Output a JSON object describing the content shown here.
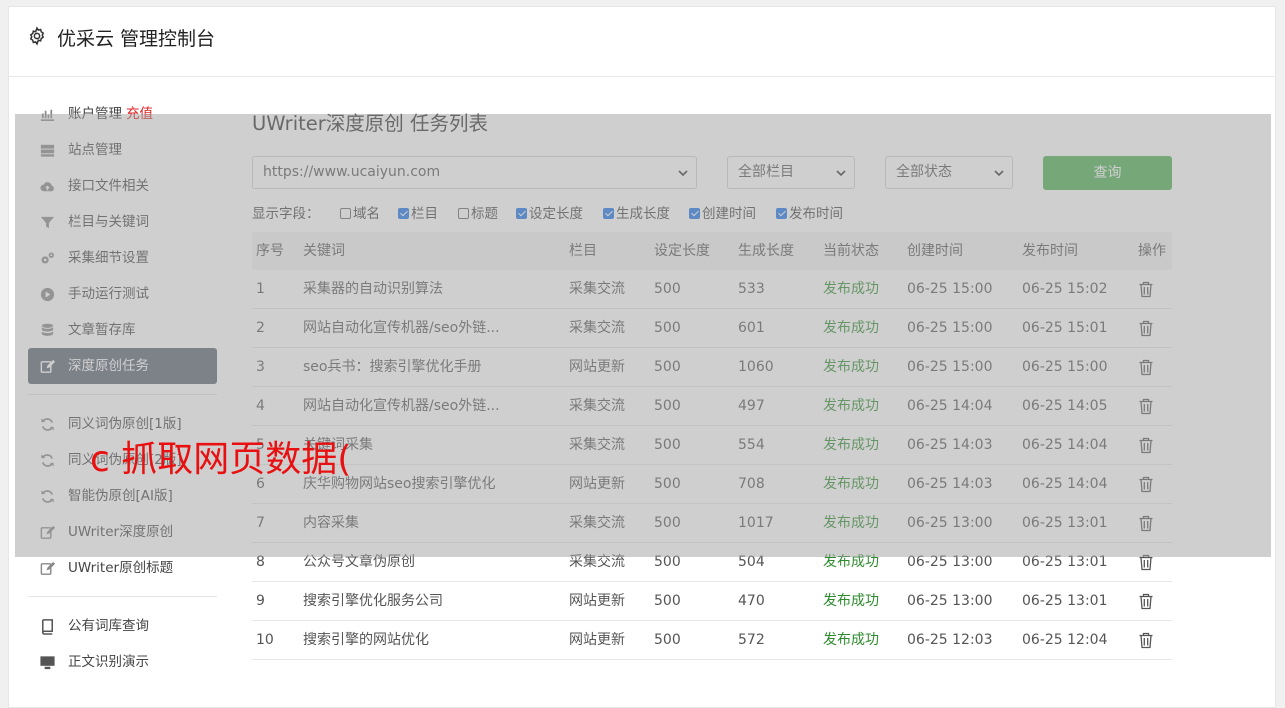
{
  "header": {
    "title": "优采云 管理控制台"
  },
  "sidebar": {
    "group1": [
      {
        "label": "账户管理",
        "extra": "充值",
        "icon": "bar-chart-icon"
      },
      {
        "label": "站点管理",
        "icon": "server-icon"
      },
      {
        "label": "接口文件相关",
        "icon": "cloud-upload-icon"
      },
      {
        "label": "栏目与关键词",
        "icon": "filter-icon"
      },
      {
        "label": "采集细节设置",
        "icon": "gears-icon"
      },
      {
        "label": "手动运行测试",
        "icon": "play-circle-icon"
      },
      {
        "label": "文章暂存库",
        "icon": "database-icon"
      },
      {
        "label": "深度原创任务",
        "icon": "edit-icon",
        "active": true
      }
    ],
    "group2": [
      {
        "label": "同义词伪原创[1版]",
        "icon": "refresh-icon"
      },
      {
        "label": "同义词伪原创[2版]",
        "icon": "refresh-icon"
      },
      {
        "label": "智能伪原创[AI版]",
        "icon": "refresh-icon"
      },
      {
        "label": "UWriter深度原创",
        "icon": "edit-icon"
      },
      {
        "label": "UWriter原创标题",
        "icon": "edit-icon"
      }
    ],
    "group3": [
      {
        "label": "公有词库查询",
        "icon": "book-icon"
      },
      {
        "label": "正文识别演示",
        "icon": "monitor-icon"
      }
    ]
  },
  "main": {
    "title": "UWriter深度原创 任务列表",
    "site_select": "https://www.ucaiyun.com",
    "column_select": "全部栏目",
    "status_select": "全部状态",
    "query_label": "查询",
    "fields_label": "显示字段：",
    "fields": [
      {
        "label": "域名",
        "checked": false
      },
      {
        "label": "栏目",
        "checked": true
      },
      {
        "label": "标题",
        "checked": false
      },
      {
        "label": "设定长度",
        "checked": true
      },
      {
        "label": "生成长度",
        "checked": true
      },
      {
        "label": "创建时间",
        "checked": true
      },
      {
        "label": "发布时间",
        "checked": true
      }
    ]
  },
  "table": {
    "headers": [
      "序号",
      "关键词",
      "栏目",
      "设定长度",
      "生成长度",
      "当前状态",
      "创建时间",
      "发布时间",
      "操作"
    ],
    "rows": [
      [
        "1",
        "采集器的自动识别算法",
        "采集交流",
        "500",
        "533",
        "发布成功",
        "06-25 15:00",
        "06-25 15:02"
      ],
      [
        "2",
        "网站自动化宣传机器/seo外链...",
        "采集交流",
        "500",
        "601",
        "发布成功",
        "06-25 15:00",
        "06-25 15:01"
      ],
      [
        "3",
        "seo兵书：搜索引擎优化手册",
        "网站更新",
        "500",
        "1060",
        "发布成功",
        "06-25 15:00",
        "06-25 15:00"
      ],
      [
        "4",
        "网站自动化宣传机器/seo外链...",
        "采集交流",
        "500",
        "497",
        "发布成功",
        "06-25 14:04",
        "06-25 14:05"
      ],
      [
        "5",
        "关键词采集",
        "采集交流",
        "500",
        "554",
        "发布成功",
        "06-25 14:03",
        "06-25 14:04"
      ],
      [
        "6",
        "庆华购物网站seo搜索引擎优化",
        "网站更新",
        "500",
        "708",
        "发布成功",
        "06-25 14:03",
        "06-25 14:04"
      ],
      [
        "7",
        "内容采集",
        "采集交流",
        "500",
        "1017",
        "发布成功",
        "06-25 13:00",
        "06-25 13:01"
      ],
      [
        "8",
        "公众号文章伪原创",
        "采集交流",
        "500",
        "504",
        "发布成功",
        "06-25 13:00",
        "06-25 13:01"
      ],
      [
        "9",
        "搜索引擎优化服务公司",
        "网站更新",
        "500",
        "470",
        "发布成功",
        "06-25 13:00",
        "06-25 13:01"
      ],
      [
        "10",
        "搜索引擎的网站优化",
        "网站更新",
        "500",
        "572",
        "发布成功",
        "06-25 12:03",
        "06-25 12:04"
      ]
    ]
  },
  "overlay": {
    "text": "c 抓取网页数据("
  }
}
